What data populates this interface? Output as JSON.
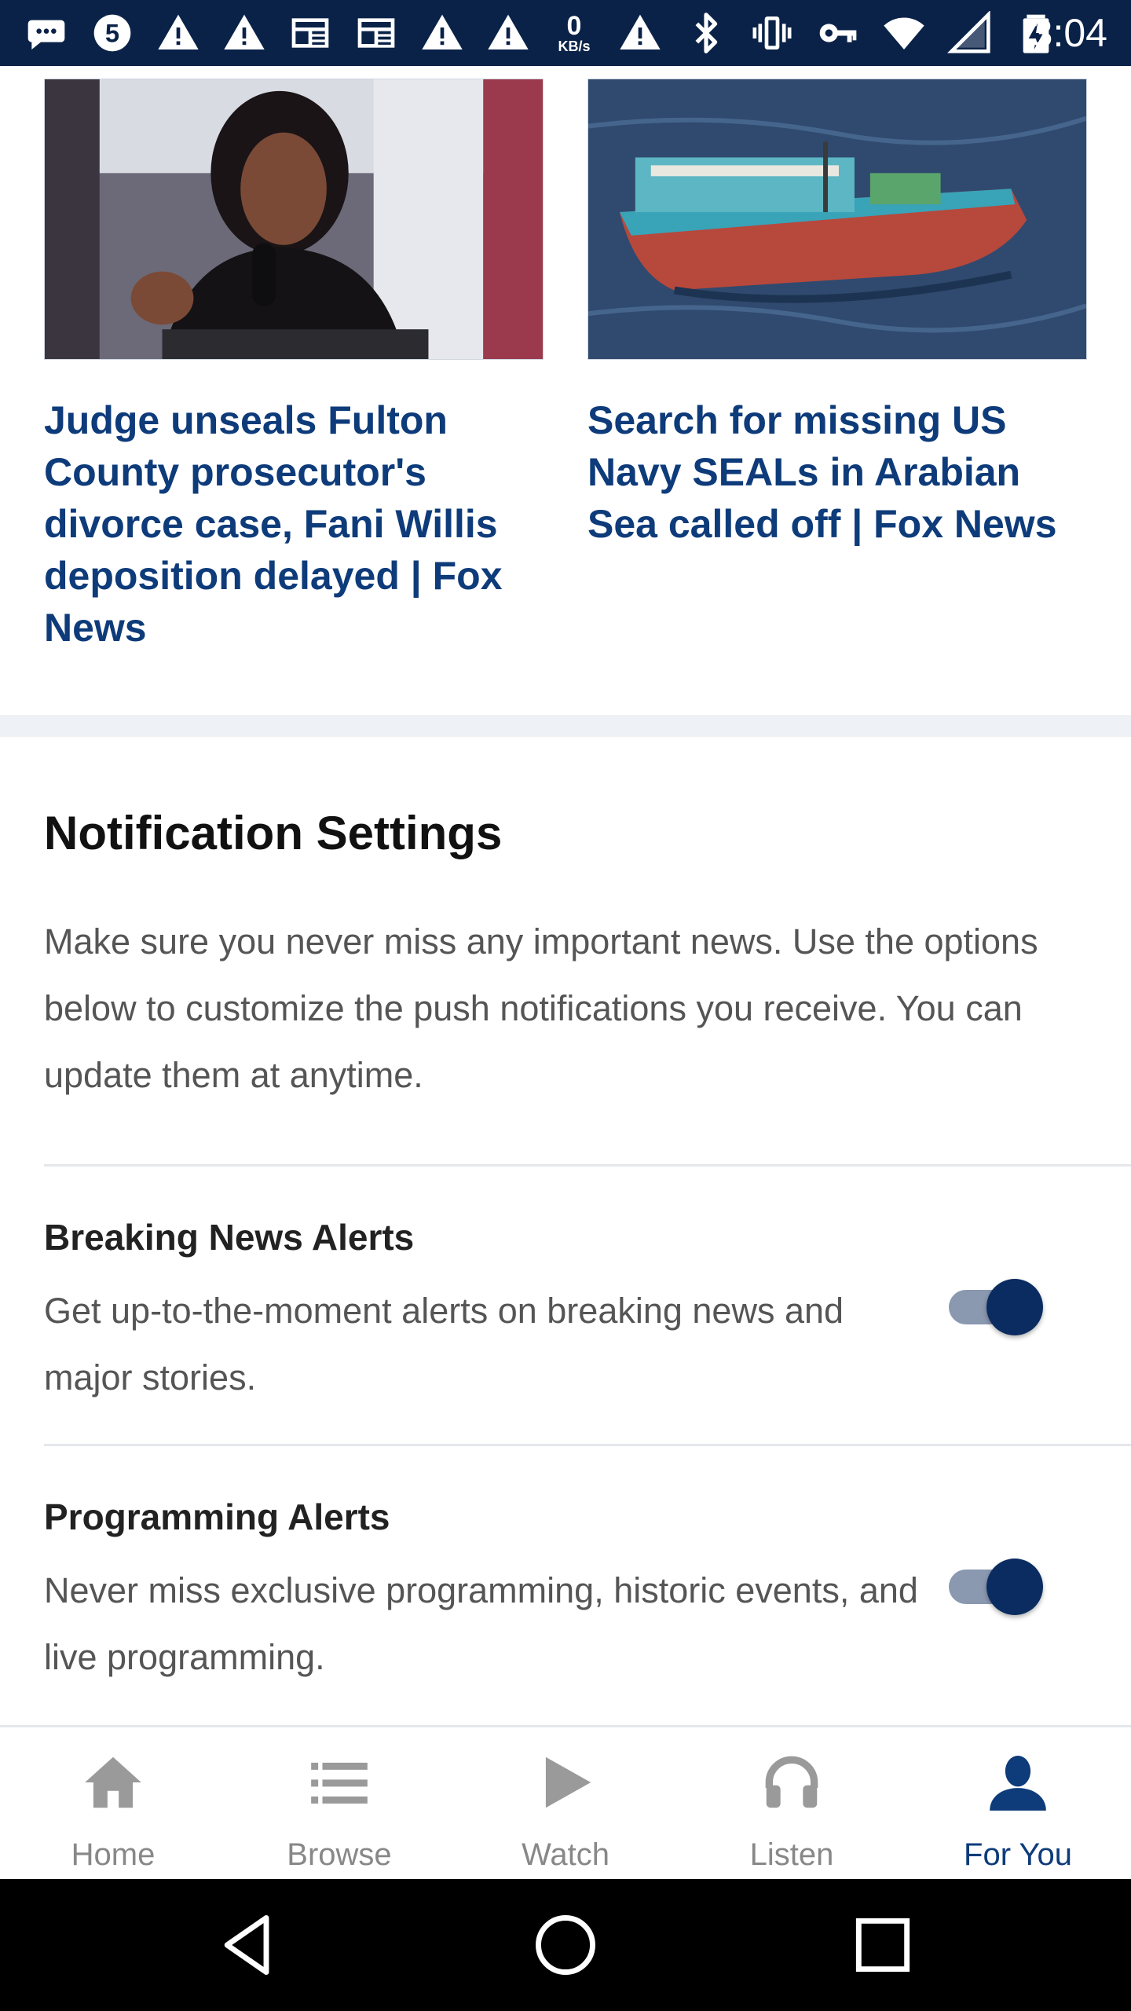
{
  "status_bar": {
    "time": "3:04",
    "network_speed_value": "0",
    "network_speed_unit": "KB/s",
    "icons": [
      "messages-icon",
      "channel-5-icon",
      "alert-icon",
      "alert-icon",
      "news-icon",
      "news-icon",
      "alert-icon",
      "alert-icon",
      "network-speed",
      "alert-icon",
      "bluetooth-icon",
      "vibrate-icon",
      "vpn-key-icon",
      "wifi-icon",
      "signal-icon",
      "battery-charging-icon"
    ]
  },
  "articles": [
    {
      "title": "Judge unseals Fulton County prosecutor's divorce case, Fani Willis deposition delayed | Fox News"
    },
    {
      "title": "Search for missing US Navy SEALs in Arabian Sea called off | Fox News"
    }
  ],
  "notification_settings": {
    "heading": "Notification Settings",
    "description": "Make sure you never miss any important news. Use the options below to customize the push notifications you receive. You can update them at anytime.",
    "items": [
      {
        "title": "Breaking News Alerts",
        "description": "Get up-to-the-moment alerts on breaking news and major stories.",
        "enabled": true
      },
      {
        "title": "Programming Alerts",
        "description": "Never miss exclusive programming, historic events, and live programming.",
        "enabled": true
      }
    ]
  },
  "bottom_nav": {
    "items": [
      {
        "label": "Home",
        "icon": "home-icon",
        "active": false
      },
      {
        "label": "Browse",
        "icon": "list-icon",
        "active": false
      },
      {
        "label": "Watch",
        "icon": "play-icon",
        "active": false
      },
      {
        "label": "Listen",
        "icon": "headphones-icon",
        "active": false
      },
      {
        "label": "For You",
        "icon": "person-icon",
        "active": true
      }
    ]
  },
  "colors": {
    "status_bar": "#0a2248",
    "headline": "#0e3b7a",
    "toggle_on": "#0a2c60",
    "nav_inactive": "#888888",
    "nav_active": "#0e3b7a"
  }
}
